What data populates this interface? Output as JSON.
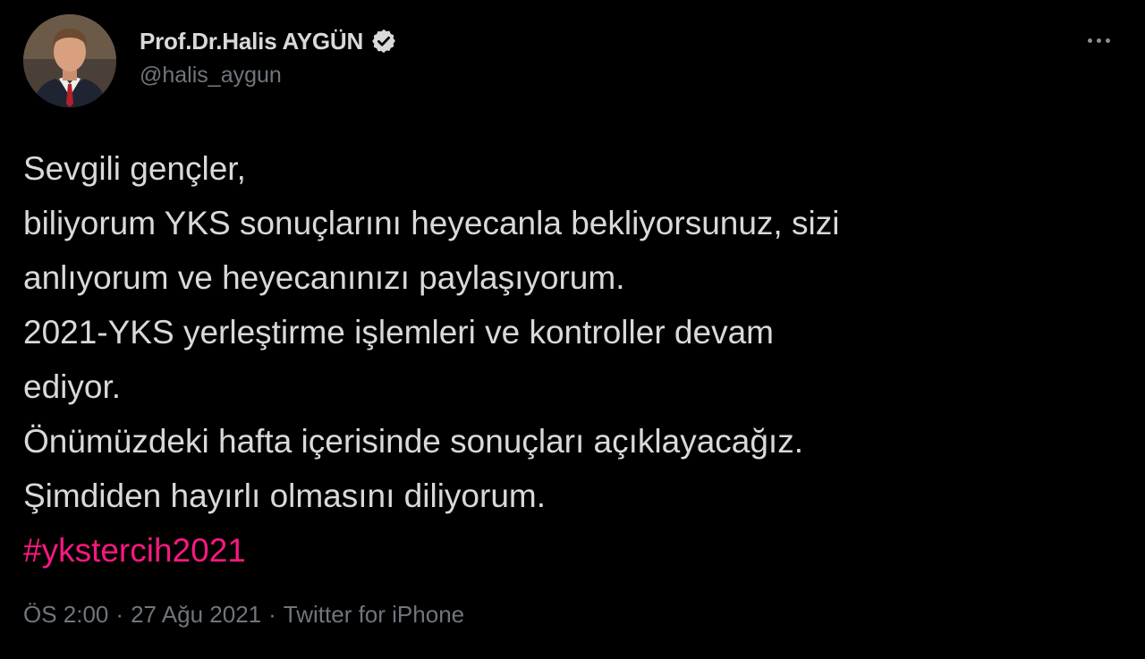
{
  "author": {
    "display_name": "Prof.Dr.Halis AYGÜN",
    "handle": "@halis_aygun",
    "verified": true
  },
  "tweet": {
    "lines": [
      "Sevgili gençler,",
      "biliyorum YKS sonuçlarını heyecanla bekliyorsunuz, sizi",
      "anlıyorum ve heyecanınızı paylaşıyorum.",
      "2021-YKS yerleştirme işlemleri ve kontroller devam",
      "ediyor.",
      "Önümüzdeki hafta içerisinde sonuçları açıklayacağız.",
      "Şimdiden hayırlı olmasını diliyorum."
    ],
    "hashtag": "#ykstercih2021"
  },
  "meta": {
    "time": "ÖS 2:00",
    "separator": "·",
    "date": "27 Ağu 2021",
    "source": "Twitter for iPhone"
  },
  "icons": {
    "verified": "verified-badge-icon",
    "more": "more-horizontal-icon"
  },
  "colors": {
    "background": "#000000",
    "text": "#d9d9d9",
    "secondary": "#6e767d",
    "hashtag": "#f91880"
  }
}
